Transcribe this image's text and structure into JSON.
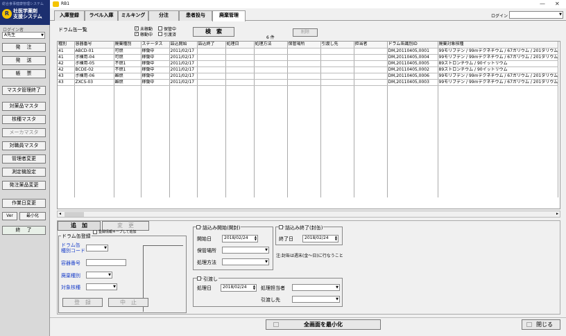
{
  "sidebar": {
    "header_small": "総合食事健康管理システム",
    "logo_letter": "R",
    "system_name_1": "社医学薬剤",
    "system_name_2": "支援システム",
    "user_label": "ログイン者",
    "user_value": "A先生",
    "buttons": [
      "発　注",
      "発　送",
      "帳　票",
      "マスタ管理終了",
      "対薬品マスタ",
      "核種マスタ",
      "メーカマスタ",
      "対職員マスタ",
      "管理者変更",
      "測定機設定",
      "発注薬品変更",
      "作業日変更"
    ],
    "ver_label": "Ver",
    "minimize_label": "最小化",
    "exit_label": "終　了"
  },
  "window": {
    "title": "RB1",
    "minimize": "—",
    "close": "✕"
  },
  "tabs": [
    "入庫登録",
    "ラベル入庫",
    "ミルキング",
    "分注",
    "患者投与",
    "廃棄管理"
  ],
  "login": {
    "label": "ログイン"
  },
  "drum": {
    "list_title": "ドラム缶一覧",
    "filters": [
      {
        "label": "未稼動",
        "checked": true
      },
      {
        "label": "保管中",
        "checked": false
      },
      {
        "label": "稼動中",
        "checked": true
      },
      {
        "label": "引渡済",
        "checked": false
      }
    ],
    "search_label": "検　索",
    "count": "6 件",
    "delete_label": "削除"
  },
  "table": {
    "columns": [
      "種別",
      "容器番号",
      "廃棄種別",
      "ステータス",
      "詰込開始",
      "詰込終了",
      "処理日",
      "処理方法",
      "保管場所",
      "引渡し先",
      "担当者",
      "ドラム缶識別ID",
      "廃棄対象核種"
    ],
    "rows": [
      [
        "41",
        "ABCD-01",
        "可燃",
        "稼働中",
        "2011/02/17",
        "",
        "",
        "",
        "",
        "",
        "",
        "DM,20110405,0001",
        "99モリブデン / 99mテクネチウム / 67ガリウム / 201タリウム"
      ],
      [
        "41",
        "ボ棟用-04",
        "可燃",
        "稼働中",
        "2011/02/17",
        "",
        "",
        "",
        "",
        "",
        "",
        "DM,20110405,0004",
        "99モリブデン / 99mテクネチウム / 67ガリウム / 201タリウム"
      ],
      [
        "42",
        "ボ棟用-05",
        "不燃1",
        "稼働中",
        "2011/02/17",
        "",
        "",
        "",
        "",
        "",
        "",
        "DM,20110405,0005",
        "89ストロンチウム / 90イットリウム"
      ],
      [
        "42",
        "BCDE-02",
        "不燃1",
        "稼働中",
        "2011/02/17",
        "",
        "",
        "",
        "",
        "",
        "",
        "DM,20110405,0002",
        "89ストロンチウム / 90イットリウム"
      ],
      [
        "43",
        "ボ棟用-06",
        "難燃",
        "稼働中",
        "2011/02/17",
        "",
        "",
        "",
        "",
        "",
        "",
        "DM,20110405,0006",
        "99モリブデン / 99mテクネチウム / 67ガリウム / 201タリウム"
      ],
      [
        "43",
        "ZXCS-03",
        "難燃",
        "稼働中",
        "2011/02/17",
        "",
        "",
        "",
        "",
        "",
        "",
        "DM,20110405,0003",
        "99モリブデン / 99mテクネチウム / 67ガリウム / 201タリウム"
      ]
    ]
  },
  "register": {
    "add_label": "追　加",
    "change_label": "変　更",
    "group_title": "ドラム缶登録",
    "keep_info_label": "登録情報キープして追加",
    "drum_code_label_1": "ドラム缶",
    "drum_code_label_2": "種別コード",
    "container_label": "容器番号",
    "waste_type_label": "廃棄種別",
    "nuclide_label": "対象核種",
    "register_label": "登　録",
    "cancel_label": "中　止"
  },
  "start": {
    "title": "詰込み開始(開封)",
    "start_date_label": "開始日",
    "start_date": "2018/02/24",
    "storage_label": "保管場所",
    "method_label": "処理方法"
  },
  "end": {
    "title": "詰込み終了(封缶)",
    "end_date_label": "終了日",
    "end_date": "2018/02/24"
  },
  "note": "注:封缶は週末(金〜日)に行なうこと",
  "handover": {
    "title": "引渡し",
    "date_label": "処理日",
    "date": "2018/02/24",
    "person_label": "処理担当者",
    "dest_label": "引渡し先"
  },
  "footer": {
    "minimize_all": "全画面を最小化",
    "close": "閉じる"
  }
}
